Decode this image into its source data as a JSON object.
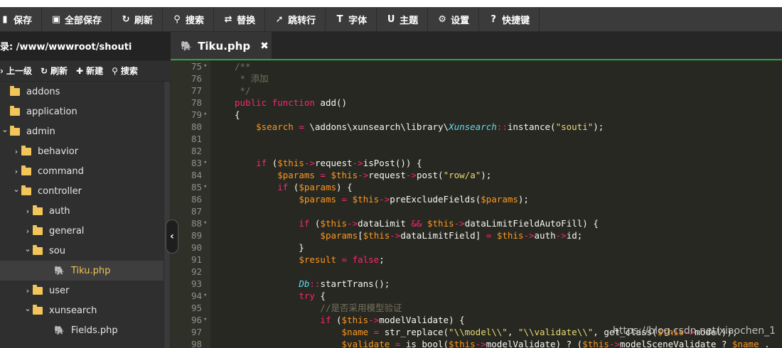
{
  "toolbar": {
    "buttons": [
      {
        "label": "保存",
        "icon": "save-icon",
        "glyph": "▮"
      },
      {
        "label": "全部保存",
        "icon": "save-all-icon",
        "glyph": "▣"
      },
      {
        "label": "刷新",
        "icon": "refresh-icon",
        "glyph": "↻"
      },
      {
        "label": "搜索",
        "icon": "search-icon",
        "glyph": "⚲"
      },
      {
        "label": "替换",
        "icon": "replace-icon",
        "glyph": "⇄"
      },
      {
        "label": "跳转行",
        "icon": "goto-line-icon",
        "glyph": "➚"
      },
      {
        "label": "字体",
        "icon": "font-icon",
        "glyph": "T"
      },
      {
        "label": "主题",
        "icon": "theme-icon",
        "glyph": "U"
      },
      {
        "label": "设置",
        "icon": "gear-icon",
        "glyph": "⚙"
      },
      {
        "label": "快捷键",
        "icon": "help-icon",
        "glyph": "?"
      }
    ]
  },
  "sidebar": {
    "path": "录: /www/wwwroot/shouti",
    "actions": [
      {
        "label": "上一级",
        "icon": "up-level-icon",
        "glyph": "›"
      },
      {
        "label": "刷新",
        "icon": "refresh-icon",
        "glyph": "↻"
      },
      {
        "label": "新建",
        "icon": "plus-icon",
        "glyph": "✚"
      },
      {
        "label": "搜索",
        "icon": "search-icon",
        "glyph": "⚲"
      }
    ],
    "tree": [
      {
        "name": "addons",
        "type": "folder",
        "depth": 0,
        "caret": ""
      },
      {
        "name": "application",
        "type": "folder",
        "depth": 0,
        "caret": ""
      },
      {
        "name": "admin",
        "type": "folder",
        "depth": 0,
        "caret": "⌄"
      },
      {
        "name": "behavior",
        "type": "folder",
        "depth": 1,
        "caret": "›"
      },
      {
        "name": "command",
        "type": "folder",
        "depth": 1,
        "caret": "›"
      },
      {
        "name": "controller",
        "type": "folder",
        "depth": 1,
        "caret": "⌄"
      },
      {
        "name": "auth",
        "type": "folder",
        "depth": 2,
        "caret": "›"
      },
      {
        "name": "general",
        "type": "folder",
        "depth": 2,
        "caret": "›"
      },
      {
        "name": "sou",
        "type": "folder",
        "depth": 2,
        "caret": "⌄"
      },
      {
        "name": "Tiku.php",
        "type": "file",
        "depth": 3,
        "caret": "",
        "selected": true
      },
      {
        "name": "user",
        "type": "folder",
        "depth": 2,
        "caret": "›"
      },
      {
        "name": "xunsearch",
        "type": "folder",
        "depth": 2,
        "caret": "⌄"
      },
      {
        "name": "Fields.php",
        "type": "file",
        "depth": 3,
        "caret": ""
      }
    ]
  },
  "tabs": [
    {
      "label": "Tiku.php",
      "icon": "php-elephant-icon",
      "close": "✖"
    }
  ],
  "collapse_glyph": "‹",
  "editor": {
    "lines": [
      {
        "n": "75",
        "fold": "▾",
        "tokens": [
          [
            "cmt",
            "/**"
          ]
        ]
      },
      {
        "n": "76",
        "fold": "",
        "tokens": [
          [
            "cmt",
            " * 添加"
          ]
        ]
      },
      {
        "n": "77",
        "fold": "",
        "tokens": [
          [
            "cmt",
            " */"
          ]
        ]
      },
      {
        "n": "78",
        "fold": "",
        "tokens": [
          [
            "kw",
            "public function "
          ],
          [
            "plain",
            "add()"
          ]
        ]
      },
      {
        "n": "79",
        "fold": "▾",
        "tokens": [
          [
            "plain",
            "{"
          ]
        ]
      },
      {
        "n": "80",
        "fold": "",
        "tokens": [
          [
            "plain",
            "    "
          ],
          [
            "var",
            "$search"
          ],
          [
            "op",
            " = "
          ],
          [
            "plain",
            "\\addons\\xunsearch\\library\\"
          ],
          [
            "cls",
            "Xunsearch"
          ],
          [
            "op",
            "::"
          ],
          [
            "plain",
            "instance("
          ],
          [
            "str",
            "\"souti\""
          ],
          [
            "plain",
            ");"
          ]
        ]
      },
      {
        "n": "81",
        "fold": "",
        "tokens": []
      },
      {
        "n": "82",
        "fold": "",
        "tokens": []
      },
      {
        "n": "83",
        "fold": "▾",
        "tokens": [
          [
            "plain",
            "    "
          ],
          [
            "kw",
            "if"
          ],
          [
            "plain",
            " ("
          ],
          [
            "var",
            "$this"
          ],
          [
            "op",
            "->"
          ],
          [
            "plain",
            "request"
          ],
          [
            "op",
            "->"
          ],
          [
            "plain",
            "isPost()) {"
          ]
        ]
      },
      {
        "n": "84",
        "fold": "",
        "tokens": [
          [
            "plain",
            "        "
          ],
          [
            "var",
            "$params"
          ],
          [
            "op",
            " = "
          ],
          [
            "var",
            "$this"
          ],
          [
            "op",
            "->"
          ],
          [
            "plain",
            "request"
          ],
          [
            "op",
            "->"
          ],
          [
            "plain",
            "post("
          ],
          [
            "str",
            "\"row/a\""
          ],
          [
            "plain",
            ");"
          ]
        ]
      },
      {
        "n": "85",
        "fold": "▾",
        "tokens": [
          [
            "plain",
            "        "
          ],
          [
            "kw",
            "if"
          ],
          [
            "plain",
            " ("
          ],
          [
            "var",
            "$params"
          ],
          [
            "plain",
            ") {"
          ]
        ]
      },
      {
        "n": "86",
        "fold": "",
        "tokens": [
          [
            "plain",
            "            "
          ],
          [
            "var",
            "$params"
          ],
          [
            "op",
            " = "
          ],
          [
            "var",
            "$this"
          ],
          [
            "op",
            "->"
          ],
          [
            "plain",
            "preExcludeFields("
          ],
          [
            "var",
            "$params"
          ],
          [
            "plain",
            ");"
          ]
        ]
      },
      {
        "n": "87",
        "fold": "",
        "tokens": []
      },
      {
        "n": "88",
        "fold": "▾",
        "tokens": [
          [
            "plain",
            "            "
          ],
          [
            "kw",
            "if"
          ],
          [
            "plain",
            " ("
          ],
          [
            "var",
            "$this"
          ],
          [
            "op",
            "->"
          ],
          [
            "plain",
            "dataLimit "
          ],
          [
            "op",
            "&&"
          ],
          [
            "plain",
            " "
          ],
          [
            "var",
            "$this"
          ],
          [
            "op",
            "->"
          ],
          [
            "plain",
            "dataLimitFieldAutoFill) {"
          ]
        ]
      },
      {
        "n": "89",
        "fold": "",
        "tokens": [
          [
            "plain",
            "                "
          ],
          [
            "var",
            "$params"
          ],
          [
            "plain",
            "["
          ],
          [
            "var",
            "$this"
          ],
          [
            "op",
            "->"
          ],
          [
            "plain",
            "dataLimitField]"
          ],
          [
            "op",
            " = "
          ],
          [
            "var",
            "$this"
          ],
          [
            "op",
            "->"
          ],
          [
            "plain",
            "auth"
          ],
          [
            "op",
            "->"
          ],
          [
            "plain",
            "id;"
          ]
        ]
      },
      {
        "n": "90",
        "fold": "",
        "tokens": [
          [
            "plain",
            "            }"
          ]
        ]
      },
      {
        "n": "91",
        "fold": "",
        "tokens": [
          [
            "plain",
            "            "
          ],
          [
            "var",
            "$result"
          ],
          [
            "op",
            " = "
          ],
          [
            "kw",
            "false"
          ],
          [
            "plain",
            ";"
          ]
        ]
      },
      {
        "n": "92",
        "fold": "",
        "tokens": []
      },
      {
        "n": "93",
        "fold": "",
        "tokens": [
          [
            "plain",
            "            "
          ],
          [
            "cls",
            "Db"
          ],
          [
            "op",
            "::"
          ],
          [
            "plain",
            "startTrans();"
          ]
        ]
      },
      {
        "n": "94",
        "fold": "▾",
        "tokens": [
          [
            "plain",
            "            "
          ],
          [
            "kw",
            "try"
          ],
          [
            "plain",
            " {"
          ]
        ]
      },
      {
        "n": "95",
        "fold": "",
        "tokens": [
          [
            "plain",
            "                "
          ],
          [
            "cmt",
            "//是否采用模型验证"
          ]
        ]
      },
      {
        "n": "96",
        "fold": "▾",
        "tokens": [
          [
            "plain",
            "                "
          ],
          [
            "kw",
            "if"
          ],
          [
            "plain",
            " ("
          ],
          [
            "var",
            "$this"
          ],
          [
            "op",
            "->"
          ],
          [
            "plain",
            "modelValidate) {"
          ]
        ]
      },
      {
        "n": "97",
        "fold": "",
        "tokens": [
          [
            "plain",
            "                    "
          ],
          [
            "var",
            "$name"
          ],
          [
            "op",
            " = "
          ],
          [
            "plain",
            "str_replace("
          ],
          [
            "str",
            "\"\\\\model\\\\\""
          ],
          [
            "plain",
            ", "
          ],
          [
            "str",
            "\"\\\\validate\\\\\""
          ],
          [
            "plain",
            ", get_class("
          ],
          [
            "var",
            "$this"
          ],
          [
            "op",
            "->"
          ],
          [
            "plain",
            "model));"
          ]
        ]
      },
      {
        "n": "98",
        "fold": "",
        "tokens": [
          [
            "plain",
            "                    "
          ],
          [
            "var",
            "$validate"
          ],
          [
            "op",
            " = "
          ],
          [
            "plain",
            "is_bool("
          ],
          [
            "var",
            "$this"
          ],
          [
            "op",
            "->"
          ],
          [
            "plain",
            "modelValidate) ? ("
          ],
          [
            "var",
            "$this"
          ],
          [
            "op",
            "->"
          ],
          [
            "plain",
            "modelSceneValidate ? "
          ],
          [
            "var",
            "$name"
          ],
          [
            "plain",
            " ."
          ]
        ]
      }
    ]
  },
  "watermark": "https://blog.csdn.net/xiaochen_1"
}
